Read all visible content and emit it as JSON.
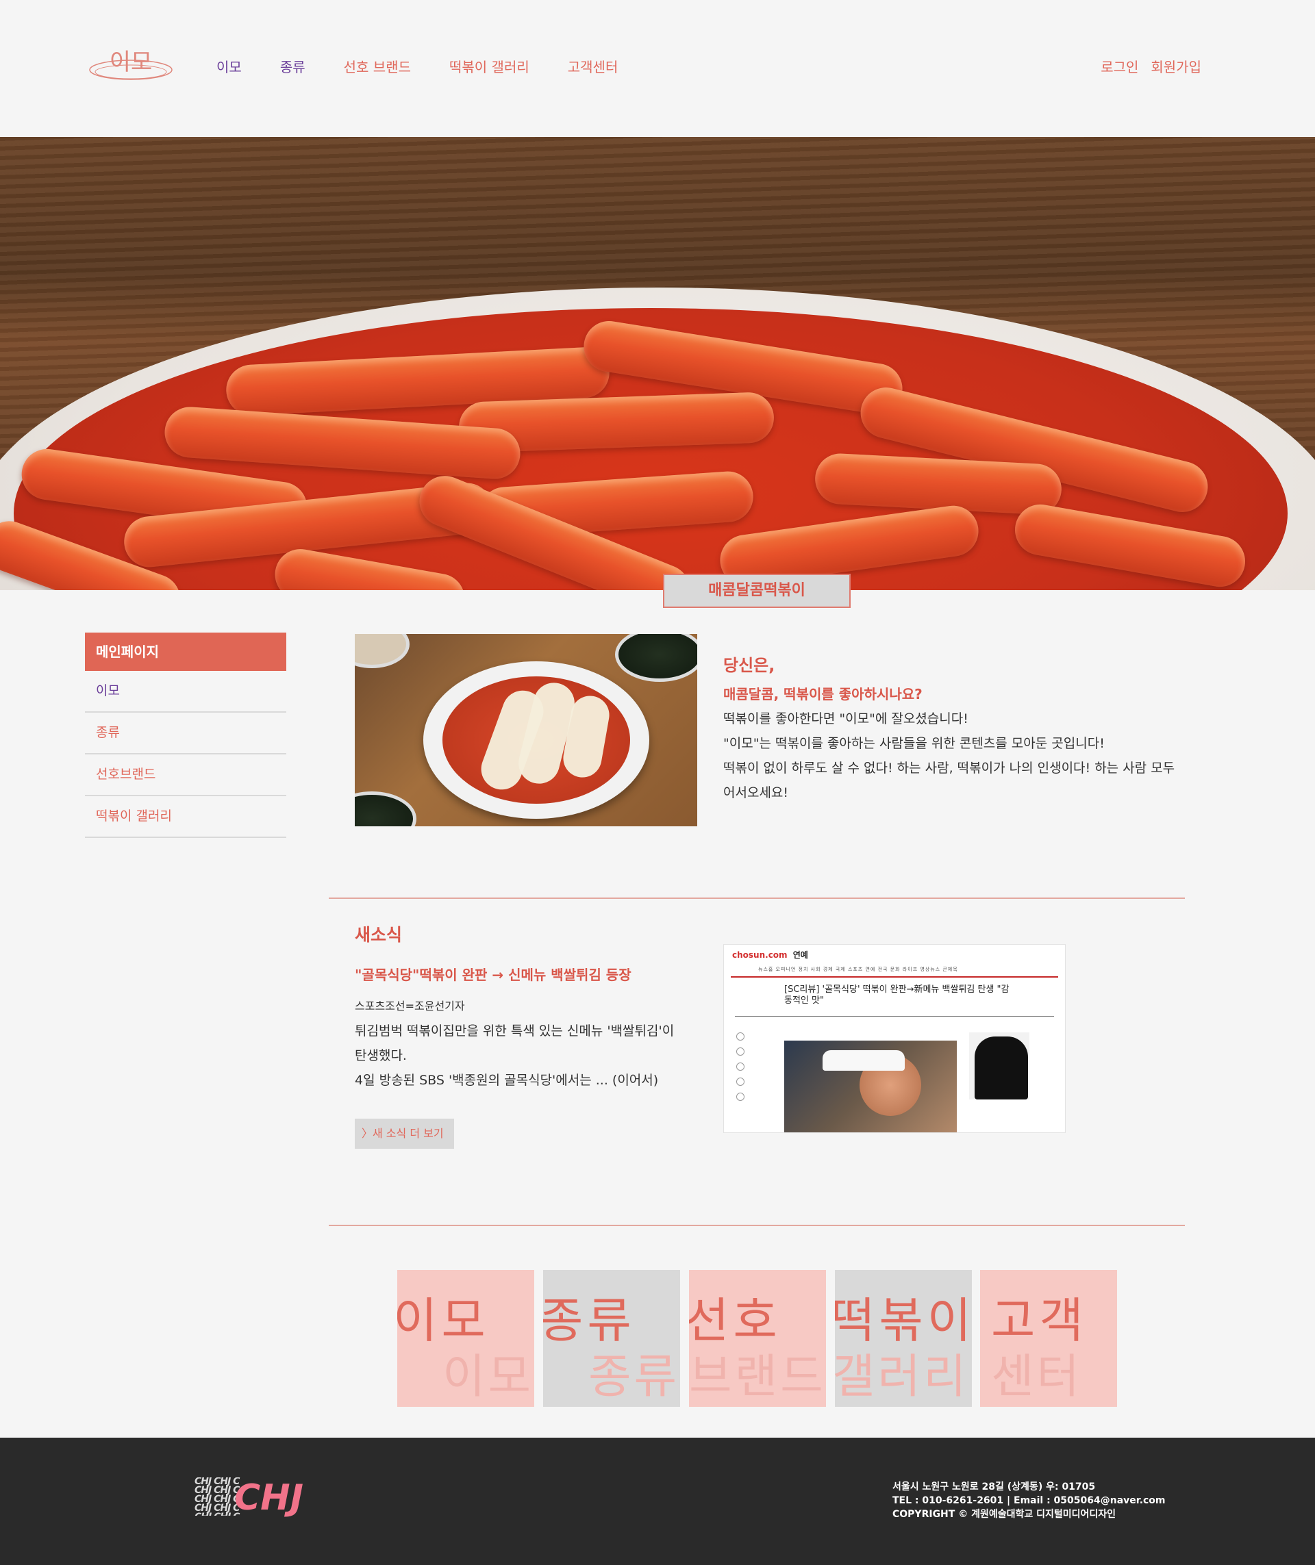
{
  "header": {
    "logo_text": "이모",
    "nav": [
      "이모",
      "종류",
      "선호 브랜드",
      "떡볶이 갤러리",
      "고객센터"
    ],
    "auth": {
      "login": "로그인",
      "signup": "회원가입"
    }
  },
  "hero": {
    "caption": "매콤달콤떡볶이"
  },
  "sidebar": {
    "title": "메인페이지",
    "items": [
      "이모",
      "종류",
      "선호브랜드",
      "떡볶이 갤러리"
    ]
  },
  "intro": {
    "line1": "당신은,",
    "line2": "매콤달콤, 떡볶이를 좋아하시나요?",
    "body": [
      "떡볶이를 좋아한다면 \"이모\"에 잘오셨습니다!",
      "\"이모\"는 떡볶이를 좋아하는 사람들을 위한 콘텐츠를 모아둔 곳입니다!",
      "떡볶이 없이 하루도 살 수 없다! 하는 사람, 떡볶이가 나의 인생이다! 하는 사람 모두",
      "어서오세요!"
    ]
  },
  "news": {
    "title": "새소식",
    "headline": "\"골목식당\"떡볶이 완판 → 신메뉴 백쌀튀김 등장",
    "byline": "스포츠조선=조윤선기자",
    "body": [
      "튀김범벅 떡볶이집만을 위한 특색 있는 신메뉴 '백쌀튀김'이",
      "탄생했다.",
      "4일 방송된 SBS '백종원의 골목식당'에서는 ... (이어서)"
    ],
    "more": "〉새 소식 더 보기",
    "screenshot": {
      "brand": "chosun.com",
      "section": "연예",
      "menu": "뉴스홈  오피니언  정치  사회  경제  국제  스포츠  연예  전국  문화  라이프  영상뉴스  큰제목",
      "title": "[SC리뷰] '골목식당' 떡볶이 완판→新메뉴 백쌀튀김 탄생 \"감동적인 맛\""
    }
  },
  "tiles": [
    {
      "big": "이모",
      "small": "이모",
      "tone": "pink"
    },
    {
      "big": "종류",
      "small": "종류",
      "tone": "gray"
    },
    {
      "big": "선호",
      "small": "브랜드",
      "tone": "pink"
    },
    {
      "big": "떡볶이",
      "small": "갤러리",
      "tone": "gray"
    },
    {
      "big": "고객",
      "small": "센터",
      "tone": "pink"
    }
  ],
  "footer": {
    "logo": "CHJ",
    "pattern": "CHJ CHJ C",
    "address": "서울시 노원구 노원로 28길 (상계동) 우: 01705",
    "contact": "TEL : 010-6261-2601  |  Email : 0505064@naver.com",
    "copyright": "COPYRIGHT © 계원예술대학교 디지털미디어디자인"
  }
}
